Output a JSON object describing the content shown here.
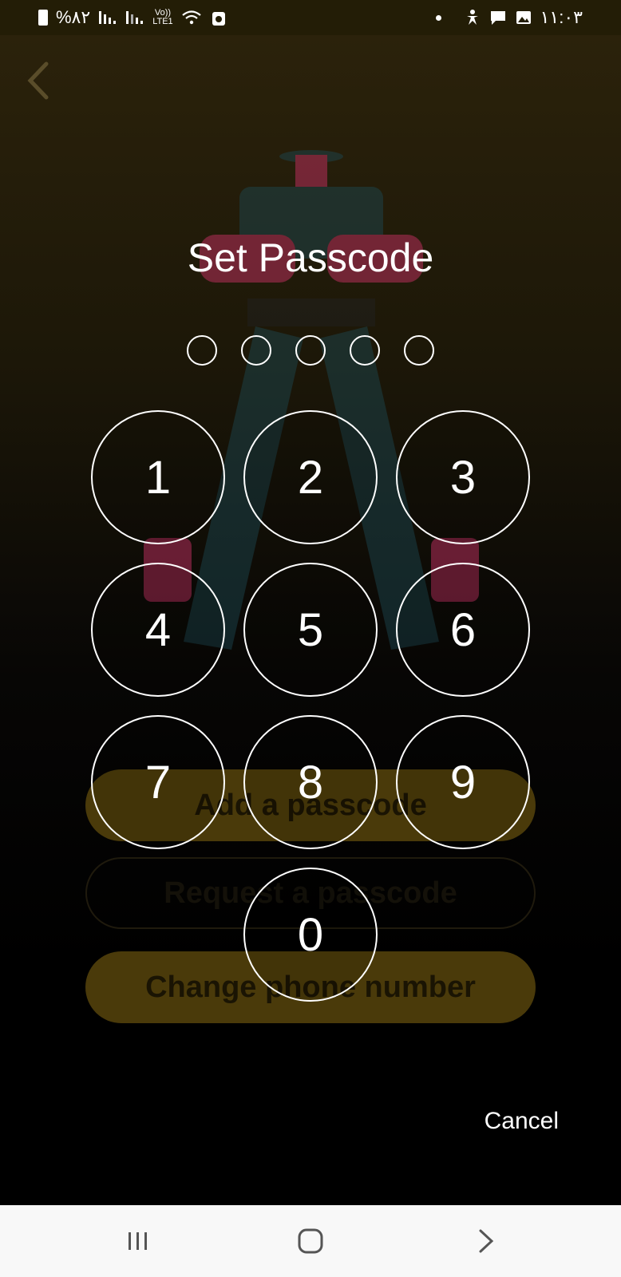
{
  "status_bar": {
    "battery_text": "%۸۲",
    "volte_top": "Vo))",
    "volte_bottom": "LTE1",
    "time": "۱۱:۰۳"
  },
  "background": {
    "buttons": [
      "Add a passcode",
      "Request a passcode",
      "Change phone number"
    ]
  },
  "passcode_dialog": {
    "title": "Set Passcode",
    "digits_total": 5,
    "digits_entered": 0,
    "keys": [
      "1",
      "2",
      "3",
      "4",
      "5",
      "6",
      "7",
      "8",
      "9",
      "0"
    ],
    "cancel_label": "Cancel"
  },
  "colors": {
    "background_top": "#2b220b",
    "background_bottom": "#000000",
    "button_accent": "#4a3a0a",
    "key_stroke": "#ffffff"
  },
  "icons": {
    "back": "chevron-left-icon",
    "nav_recents": "recents-icon",
    "nav_home": "home-icon",
    "nav_back": "chevron-right-icon"
  }
}
